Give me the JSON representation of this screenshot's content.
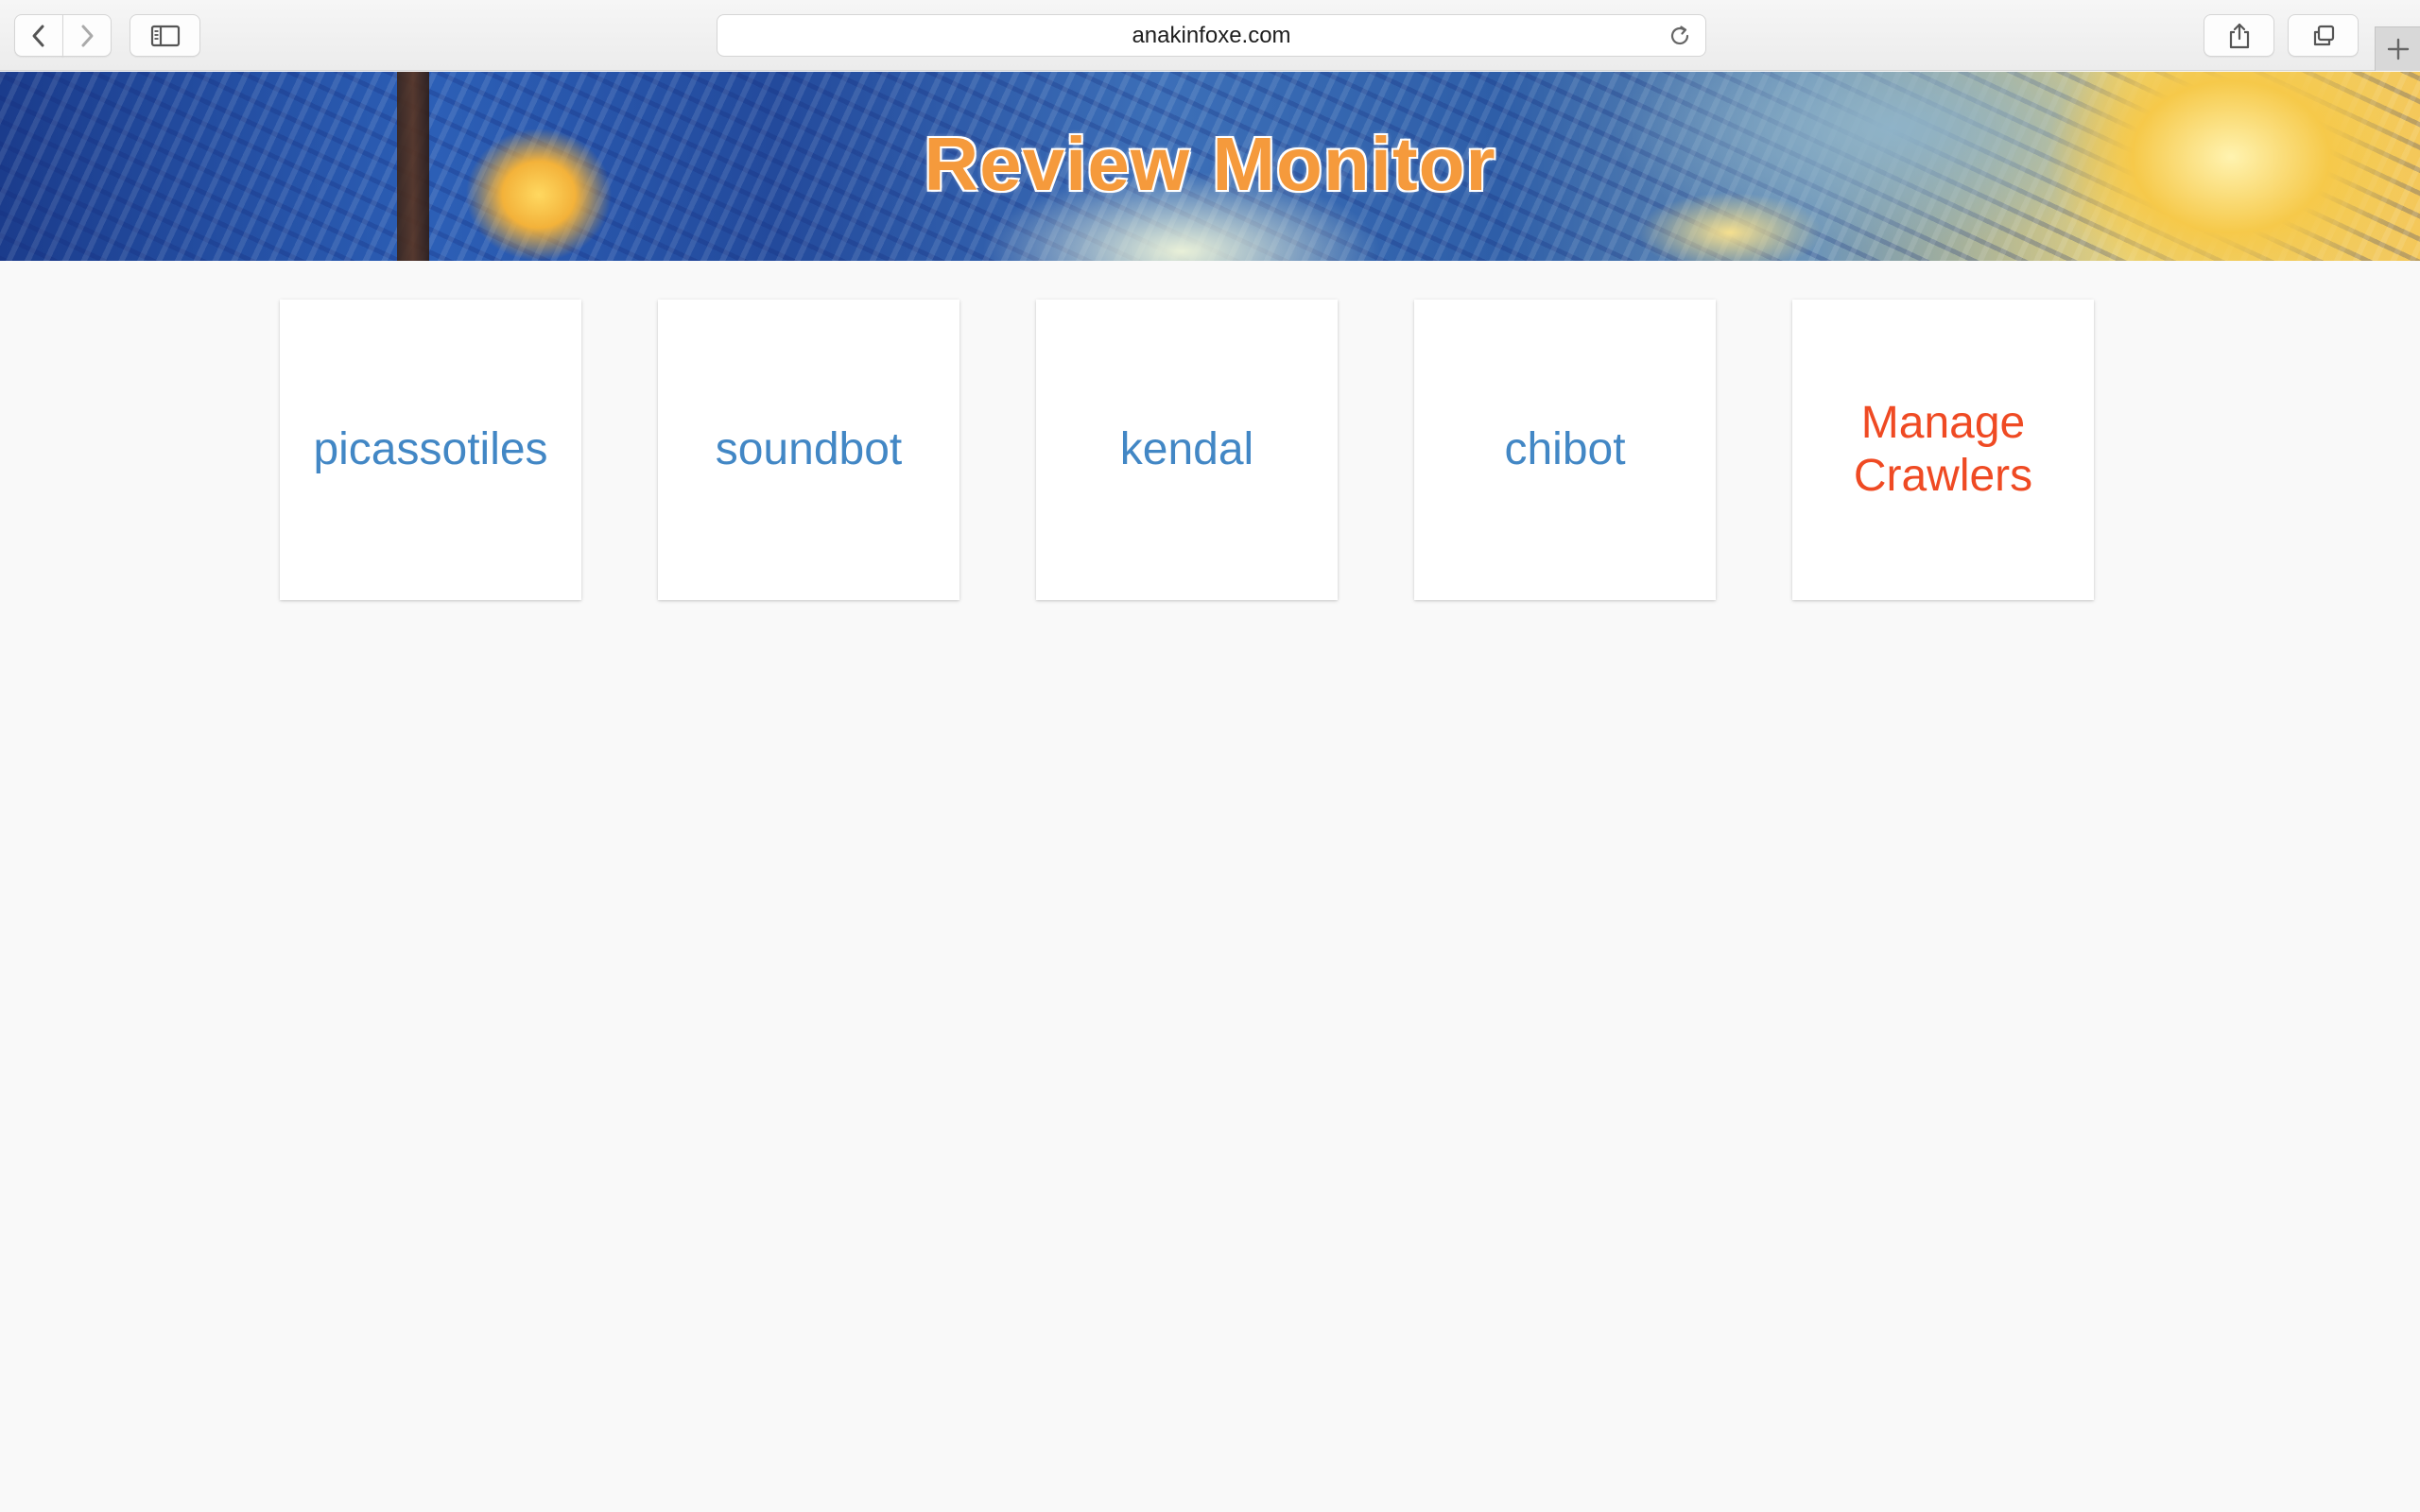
{
  "browser": {
    "url": "anakinfoxe.com",
    "icons": {
      "back": "chevron-left-icon",
      "forward": "chevron-right-icon",
      "sidebar": "sidebar-icon",
      "reload": "reload-icon",
      "share": "share-icon",
      "tabs": "tabs-overview-icon",
      "new_tab": "plus-icon"
    }
  },
  "header": {
    "title": "Review Monitor",
    "title_color": "#f59a3c"
  },
  "projects": [
    {
      "label": "picassotiles",
      "color": "#4287c5"
    },
    {
      "label": "soundbot",
      "color": "#4287c5"
    },
    {
      "label": "kendal",
      "color": "#4287c5"
    },
    {
      "label": "chibot",
      "color": "#4287c5"
    }
  ],
  "manage": {
    "label": "Manage Crawlers",
    "color": "#ef4a23"
  }
}
